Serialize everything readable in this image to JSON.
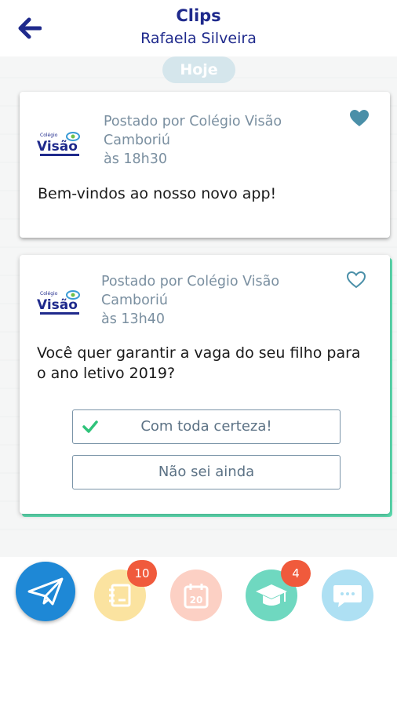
{
  "header": {
    "title": "Clips",
    "subtitle": "Rafaela Silveira"
  },
  "feed": {
    "day_label": "Hoje",
    "posts": [
      {
        "logo_text_top": "Colégio",
        "logo_text": "Visão",
        "posted_by": "Postado por Colégio Visão Camboriú",
        "time": "às 18h30",
        "message": "Bem-vindos ao nosso novo app!",
        "liked": true
      },
      {
        "logo_text_top": "Colégio",
        "logo_text": "Visão",
        "posted_by": "Postado por Colégio Visão Camboriú",
        "time": "às 13h40",
        "message": "Você quer garantir a vaga do seu filho para o ano letivo 2019?",
        "liked": false,
        "options": [
          {
            "label": "Com toda certeza!",
            "selected": true
          },
          {
            "label": "Não sei ainda",
            "selected": false
          }
        ]
      }
    ]
  },
  "nav": {
    "items": [
      {
        "icon": "paper-plane-icon",
        "color": "#1e88d6",
        "badge": ""
      },
      {
        "icon": "notebook-icon",
        "color": "#fbe3a0",
        "badge": "10"
      },
      {
        "icon": "calendar-icon",
        "color": "#fcd0c4",
        "badge": "",
        "date_text": "20"
      },
      {
        "icon": "graduation-cap-icon",
        "color": "#6fd8c0",
        "badge": "4"
      },
      {
        "icon": "chat-icon",
        "color": "#aee0f3",
        "badge": ""
      }
    ]
  },
  "colors": {
    "primary": "#1f2a8c",
    "meta_text": "#7a8fa0",
    "heart": "#4a8fa8",
    "accent_green": "#5fe0b3",
    "badge": "#f05a3c"
  }
}
